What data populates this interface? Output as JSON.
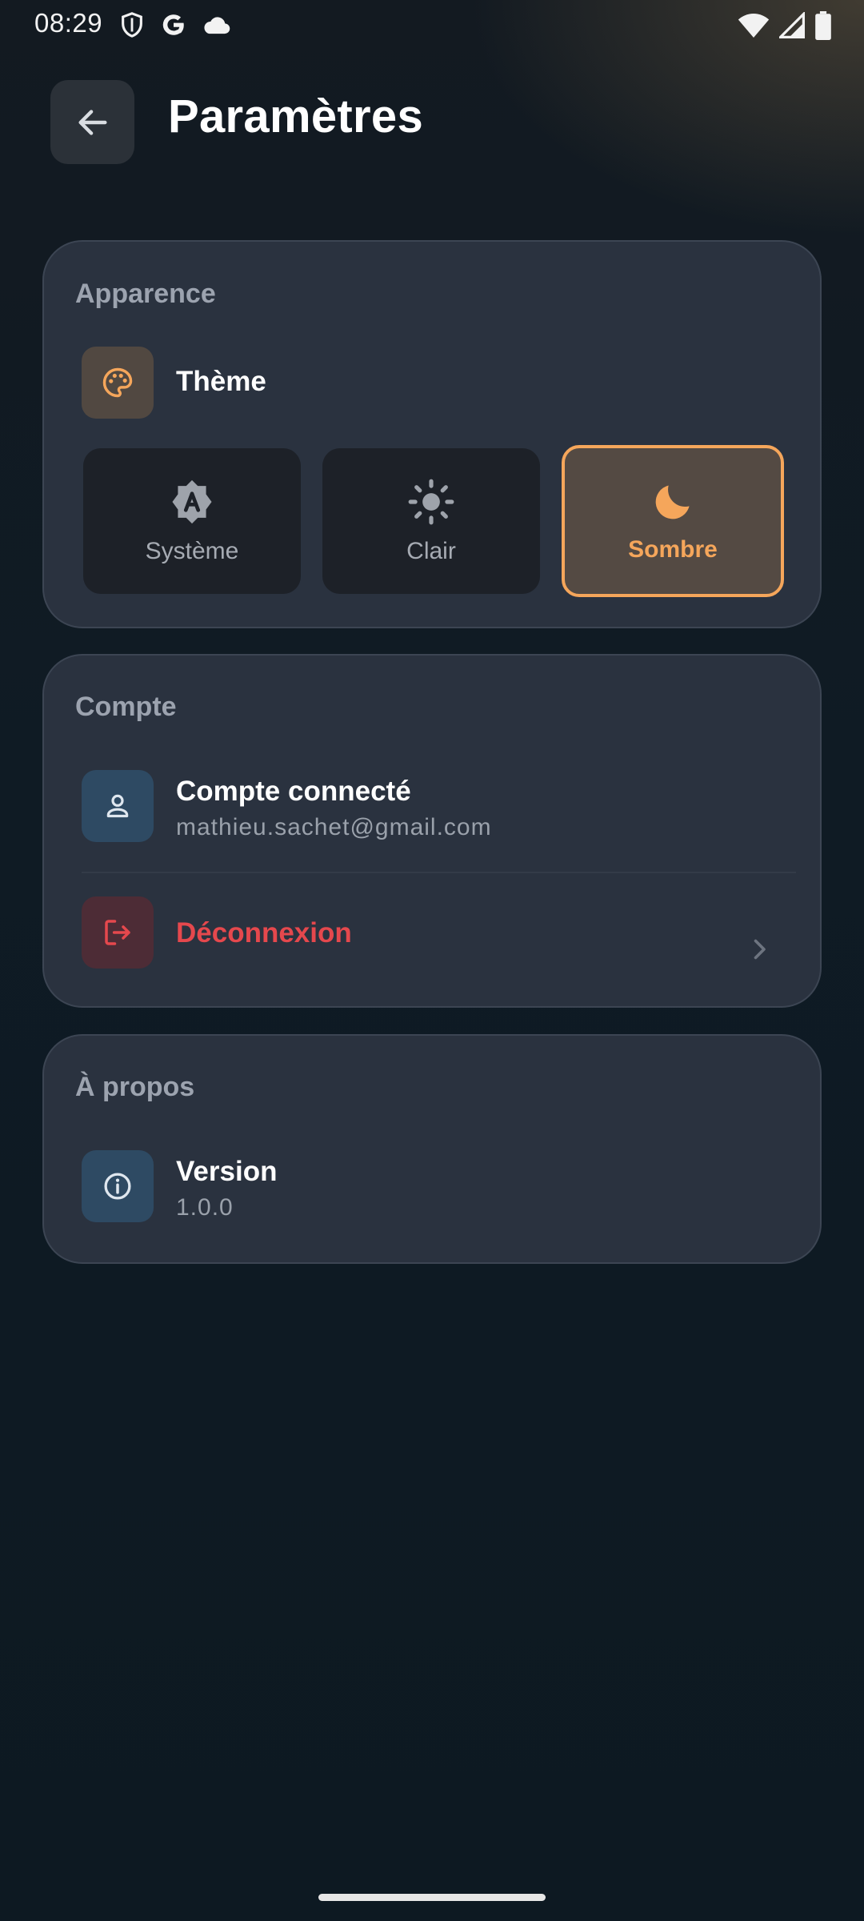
{
  "status_bar": {
    "time": "08:29",
    "left_icons": [
      "shield-icon",
      "google-icon",
      "cloud-icon"
    ],
    "right_icons": [
      "wifi-icon",
      "signal-icon",
      "battery-icon"
    ]
  },
  "header": {
    "title": "Paramètres",
    "back_icon": "arrow-left-icon"
  },
  "sections": {
    "appearance": {
      "title": "Apparence",
      "theme_row": {
        "label": "Thème",
        "icon": "palette-icon"
      },
      "theme_options": [
        {
          "label": "Système",
          "icon": "auto-brightness-icon",
          "selected": false
        },
        {
          "label": "Clair",
          "icon": "sun-icon",
          "selected": false
        },
        {
          "label": "Sombre",
          "icon": "moon-icon",
          "selected": true
        }
      ]
    },
    "account": {
      "title": "Compte",
      "connected": {
        "title": "Compte connecté",
        "email": "mathieu.sachet@gmail.com",
        "icon": "user-icon"
      },
      "logout": {
        "label": "Déconnexion",
        "icon": "logout-icon"
      }
    },
    "about": {
      "title": "À propos",
      "version": {
        "title": "Version",
        "value": "1.0.0",
        "icon": "info-icon"
      }
    }
  },
  "colors": {
    "accent": "#f5a65b",
    "danger": "#e5484d",
    "card": "#2a323f",
    "background": "#0f1b24"
  }
}
